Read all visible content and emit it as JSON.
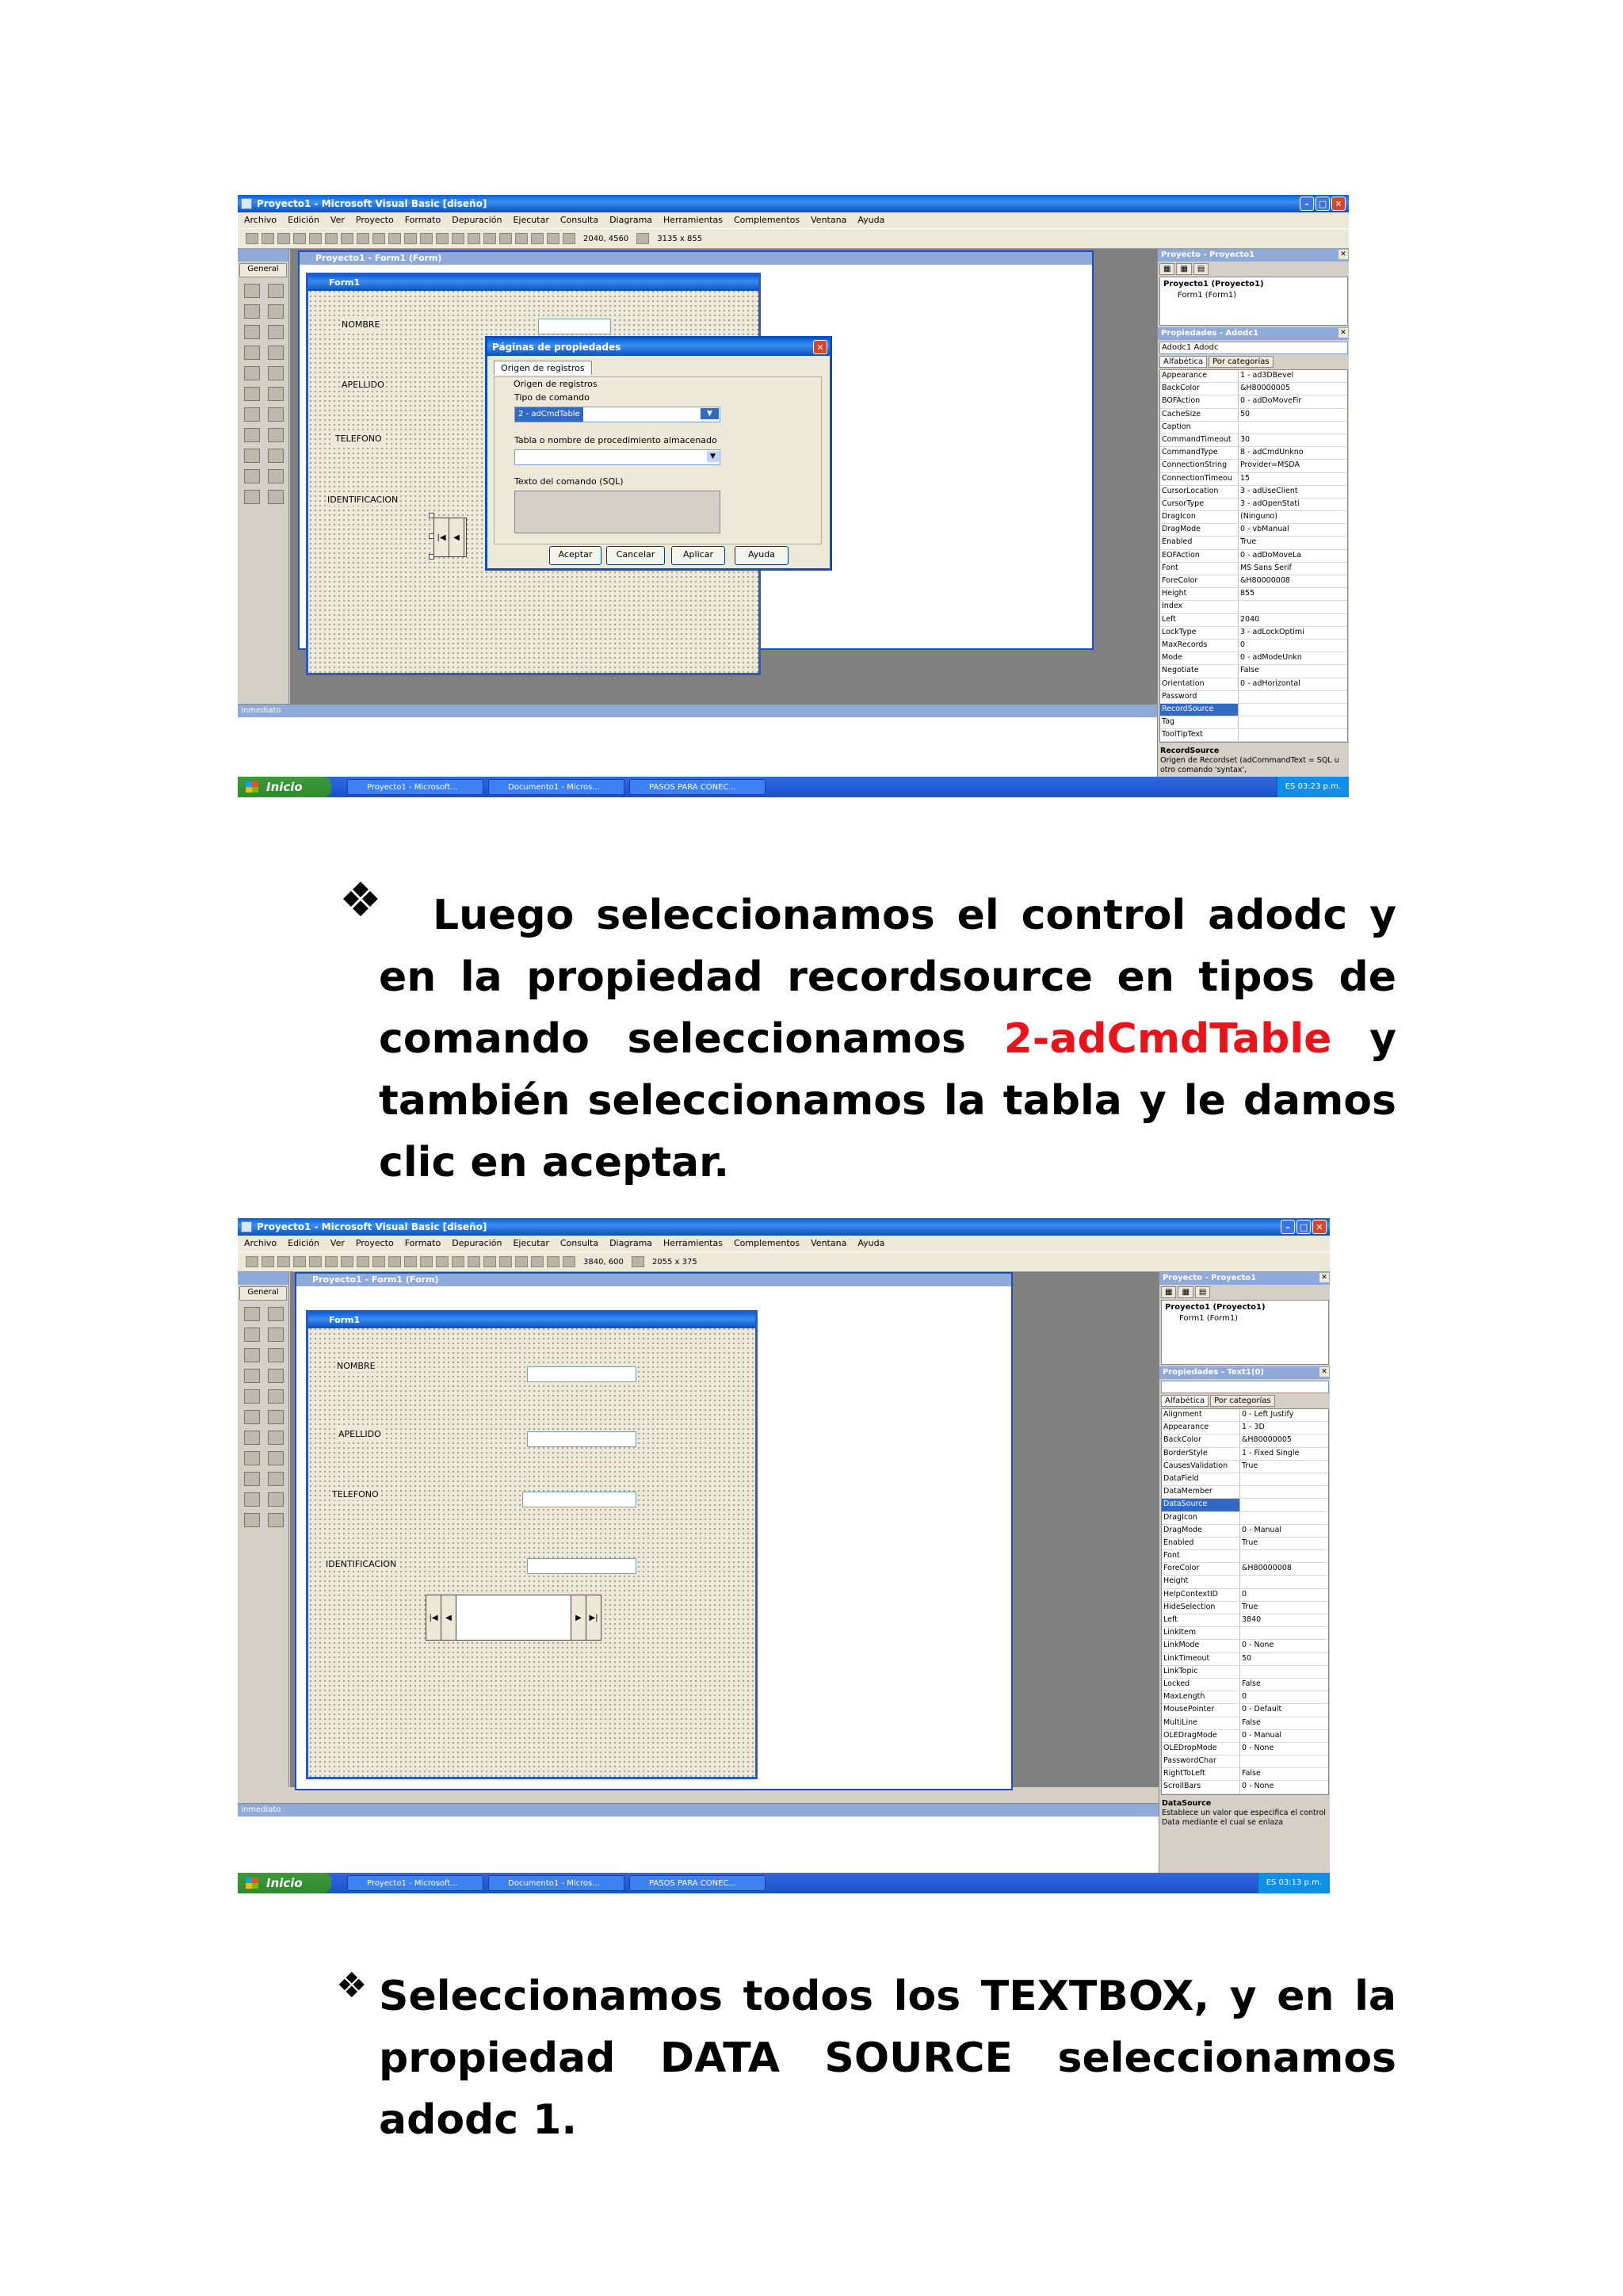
{
  "screenshot1": {
    "window_title": "Proyecto1 - Microsoft Visual Basic [diseño]",
    "menu": [
      "Archivo",
      "Edición",
      "Ver",
      "Proyecto",
      "Formato",
      "Depuración",
      "Ejecutar",
      "Consulta",
      "Diagrama",
      "Herramientas",
      "Complementos",
      "Ventana",
      "Ayuda"
    ],
    "coords": "2040, 4560",
    "size": "3135 x 855",
    "toolbox_label": "General",
    "designer_title": "Proyecto1 - Form1 (Form)",
    "form_title": "Form1",
    "labels": [
      "NOMBRE",
      "APELLIDO",
      "TELEFONO",
      "IDENTIFICACION"
    ],
    "dialog": {
      "title": "Páginas de propiedades",
      "tab": "Origen de registros",
      "group": "Origen de registros",
      "command_type_label": "Tipo de comando",
      "command_type_value": "2 - adCmdTable",
      "table_label": "Tabla o nombre de procedimiento almacenado",
      "sql_label": "Texto del comando (SQL)",
      "buttons": [
        "Aceptar",
        "Cancelar",
        "Aplicar",
        "Ayuda"
      ]
    },
    "project_panel_title": "Proyecto - Proyecto1",
    "project_tree": [
      "Proyecto1 (Proyecto1)",
      "Form1 (Form1)"
    ],
    "props_panel_title": "Propiedades - Adodc1",
    "props_object": "Adodc1  Adodc",
    "props_tabs": [
      "Alfabética",
      "Por categorías"
    ],
    "props": [
      [
        "Appearance",
        "1 - ad3DBevel"
      ],
      [
        "BackColor",
        "&H80000005"
      ],
      [
        "BOFAction",
        "0 - adDoMoveFir"
      ],
      [
        "CacheSize",
        "50"
      ],
      [
        "Caption",
        ""
      ],
      [
        "CommandTimeout",
        "30"
      ],
      [
        "CommandType",
        "8 - adCmdUnkno"
      ],
      [
        "ConnectionString",
        "Provider=MSDA"
      ],
      [
        "ConnectionTimeou",
        "15"
      ],
      [
        "CursorLocation",
        "3 - adUseClient"
      ],
      [
        "CursorType",
        "3 - adOpenStati"
      ],
      [
        "DragIcon",
        "(Ninguno)"
      ],
      [
        "DragMode",
        "0 - vbManual"
      ],
      [
        "Enabled",
        "True"
      ],
      [
        "EOFAction",
        "0 - adDoMoveLa"
      ],
      [
        "Font",
        "MS Sans Serif"
      ],
      [
        "ForeColor",
        "&H80000008"
      ],
      [
        "Height",
        "855"
      ],
      [
        "Index",
        ""
      ],
      [
        "Left",
        "2040"
      ],
      [
        "LockType",
        "3 - adLockOptimi"
      ],
      [
        "MaxRecords",
        "0"
      ],
      [
        "Mode",
        "0 - adModeUnkn"
      ],
      [
        "Negotiate",
        "False"
      ],
      [
        "Orientation",
        "0 - adHorizontal"
      ],
      [
        "Password",
        ""
      ],
      [
        "RecordSource",
        ""
      ],
      [
        "Tag",
        ""
      ],
      [
        "ToolTipText",
        ""
      ]
    ],
    "prop_desc_title": "RecordSource",
    "prop_desc_text": "Origen de Recordset (adCommandText = SQL u otro comando 'syntax',",
    "immediate_title": "Inmediato",
    "start_label": "Inicio",
    "tasks": [
      "Proyecto1 - Microsoft...",
      "Documento1 - Micros...",
      "PASOS PARA CONEC..."
    ],
    "tray": "ES  03:23 p.m."
  },
  "para1": {
    "part1": "Luego seleccionamos el control adodc y en la propiedad recordsource en tipos de comando seleccionamos",
    "highlight": "2-adCmdTable",
    "part2": "y también seleccionamos la tabla y le damos clic en aceptar."
  },
  "screenshot2": {
    "window_title": "Proyecto1 - Microsoft Visual Basic [diseño]",
    "menu": [
      "Archivo",
      "Edición",
      "Ver",
      "Proyecto",
      "Formato",
      "Depuración",
      "Ejecutar",
      "Consulta",
      "Diagrama",
      "Herramientas",
      "Complementos",
      "Ventana",
      "Ayuda"
    ],
    "coords": "3840, 600",
    "size": "2055 x 375",
    "toolbox_label": "General",
    "designer_title": "Proyecto1 - Form1 (Form)",
    "form_title": "Form1",
    "labels": [
      "NOMBRE",
      "APELLIDO",
      "TELEFONO",
      "IDENTIFICACION"
    ],
    "project_panel_title": "Proyecto - Proyecto1",
    "project_tree": [
      "Proyecto1 (Proyecto1)",
      "Form1 (Form1)"
    ],
    "props_panel_title": "Propiedades - Text1(0)",
    "props_tabs": [
      "Alfabética",
      "Por categorías"
    ],
    "props": [
      [
        "Alignment",
        "0 - Left Justify"
      ],
      [
        "Appearance",
        "1 - 3D"
      ],
      [
        "BackColor",
        "&H80000005"
      ],
      [
        "BorderStyle",
        "1 - Fixed Single"
      ],
      [
        "CausesValidation",
        "True"
      ],
      [
        "DataField",
        ""
      ],
      [
        "DataMember",
        ""
      ],
      [
        "DataSource",
        ""
      ],
      [
        "DragIcon",
        ""
      ],
      [
        "DragMode",
        "0 - Manual"
      ],
      [
        "Enabled",
        "True"
      ],
      [
        "Font",
        ""
      ],
      [
        "ForeColor",
        "&H80000008"
      ],
      [
        "Height",
        ""
      ],
      [
        "HelpContextID",
        "0"
      ],
      [
        "HideSelection",
        "True"
      ],
      [
        "Left",
        "3840"
      ],
      [
        "LinkItem",
        ""
      ],
      [
        "LinkMode",
        "0 - None"
      ],
      [
        "LinkTimeout",
        "50"
      ],
      [
        "LinkTopic",
        ""
      ],
      [
        "Locked",
        "False"
      ],
      [
        "MaxLength",
        "0"
      ],
      [
        "MousePointer",
        "0 - Default"
      ],
      [
        "MultiLine",
        "False"
      ],
      [
        "OLEDragMode",
        "0 - Manual"
      ],
      [
        "OLEDropMode",
        "0 - None"
      ],
      [
        "PasswordChar",
        ""
      ],
      [
        "RightToLeft",
        "False"
      ],
      [
        "ScrollBars",
        "0 - None"
      ]
    ],
    "prop_desc_title": "DataSource",
    "prop_desc_text": "Establece un valor que especifica el control Data mediante el cual se enlaza",
    "immediate_title": "Inmediato",
    "start_label": "Inicio",
    "tasks": [
      "Proyecto1 - Microsoft...",
      "Documento1 - Micros...",
      "PASOS PARA CONEC..."
    ],
    "tray": "ES  03:13 p.m."
  },
  "para2": {
    "text": "Seleccionamos todos los TEXTBOX, y en la propiedad DATA SOURCE seleccionamos adodc 1."
  }
}
